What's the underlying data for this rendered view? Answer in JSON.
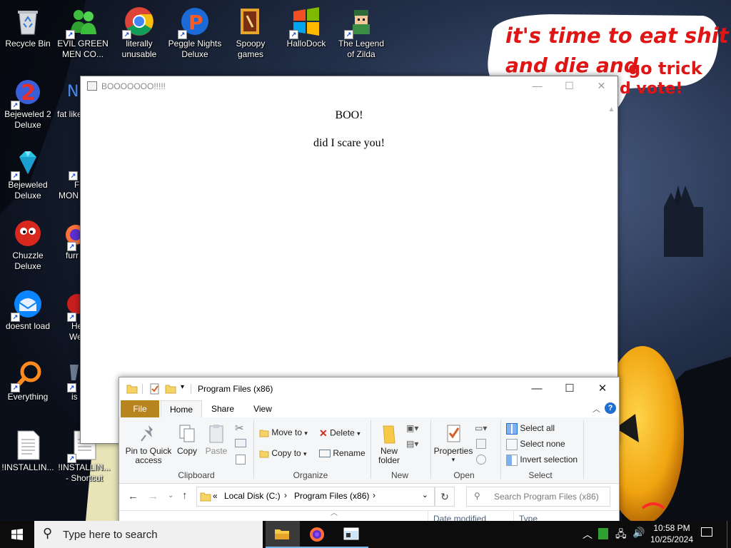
{
  "wallpaper": {
    "speech_line1": "it's time to eat shit",
    "speech_line2_a": "and die and",
    "speech_line2_b": "go trick",
    "speech_line3": "d vote!",
    "accent_red": "#e01515"
  },
  "desktop": {
    "icons": [
      {
        "label": "Recycle Bin",
        "icon": "recycle-bin-icon"
      },
      {
        "label": "EVIL GREEN MEN CO...",
        "icon": "green-men-icon"
      },
      {
        "label": "literally unusable",
        "icon": "chrome-icon"
      },
      {
        "label": "Peggle Nights Deluxe",
        "icon": "peggle-icon"
      },
      {
        "label": "Spoopy games",
        "icon": "spoopy-folder-icon"
      },
      {
        "label": "HalloDock",
        "icon": "windows-logo-icon"
      },
      {
        "label": "The Legend of Zilda",
        "icon": "zelda-icon"
      },
      {
        "label": "Bejeweled 2 Deluxe",
        "icon": "bejeweled2-icon"
      },
      {
        "label": "fat like",
        "icon": "app-icon"
      },
      {
        "label": "Bejeweled Deluxe",
        "icon": "gem-icon"
      },
      {
        "label": "F",
        "icon": "app-icon"
      },
      {
        "label": "MON",
        "icon": "app-icon"
      },
      {
        "label": "Chuzzle Deluxe",
        "icon": "chuzzle-icon"
      },
      {
        "label": "furr",
        "icon": "firefox-icon"
      },
      {
        "label": "doesnt load",
        "icon": "thunderbird-icon"
      },
      {
        "label": "He",
        "icon": "app-icon"
      },
      {
        "label": "We",
        "icon": "app-icon"
      },
      {
        "label": "Everything",
        "icon": "everything-search-icon"
      },
      {
        "label": "is",
        "icon": "app-icon"
      },
      {
        "label": "!INSTALLIN...",
        "icon": "document-icon"
      },
      {
        "label": "!INSTALLIN...",
        "icon": "document-icon"
      },
      {
        "label": "- Shortcut",
        "icon": "document-icon"
      }
    ]
  },
  "boo_window": {
    "title": "BOOOOOOO!!!!!",
    "heading": "BOO!",
    "line": "did I scare you!"
  },
  "explorer": {
    "title": "Program Files (x86)",
    "tabs": [
      "File",
      "Home",
      "Share",
      "View"
    ],
    "active_tab": "Home",
    "file_tab_color": "#b8841f",
    "clipboard": {
      "pin": "Pin to Quick access",
      "pin_line1": "Pin to Quick",
      "pin_line2": "access",
      "copy": "Copy",
      "paste": "Paste",
      "label": "Clipboard"
    },
    "organize": {
      "move_to": "Move to",
      "copy_to": "Copy to",
      "delete": "Delete",
      "rename": "Rename",
      "label": "Organize"
    },
    "new": {
      "new_folder_line1": "New",
      "new_folder_line2": "folder",
      "label": "New"
    },
    "open": {
      "properties": "Properties",
      "label": "Open"
    },
    "select": {
      "select_all": "Select all",
      "select_none": "Select none",
      "invert": "Invert selection",
      "label": "Select"
    },
    "address": {
      "overflow": "«",
      "crumbs": [
        "Local Disk (C:)",
        "Program Files (x86)"
      ],
      "search_placeholder": "Search Program Files (x86)"
    },
    "columns": {
      "date_modified": "Date modified",
      "type": "Type"
    }
  },
  "taskbar": {
    "search_placeholder": "Type here to search",
    "time": "10:58 PM",
    "date": "10/25/2024"
  }
}
